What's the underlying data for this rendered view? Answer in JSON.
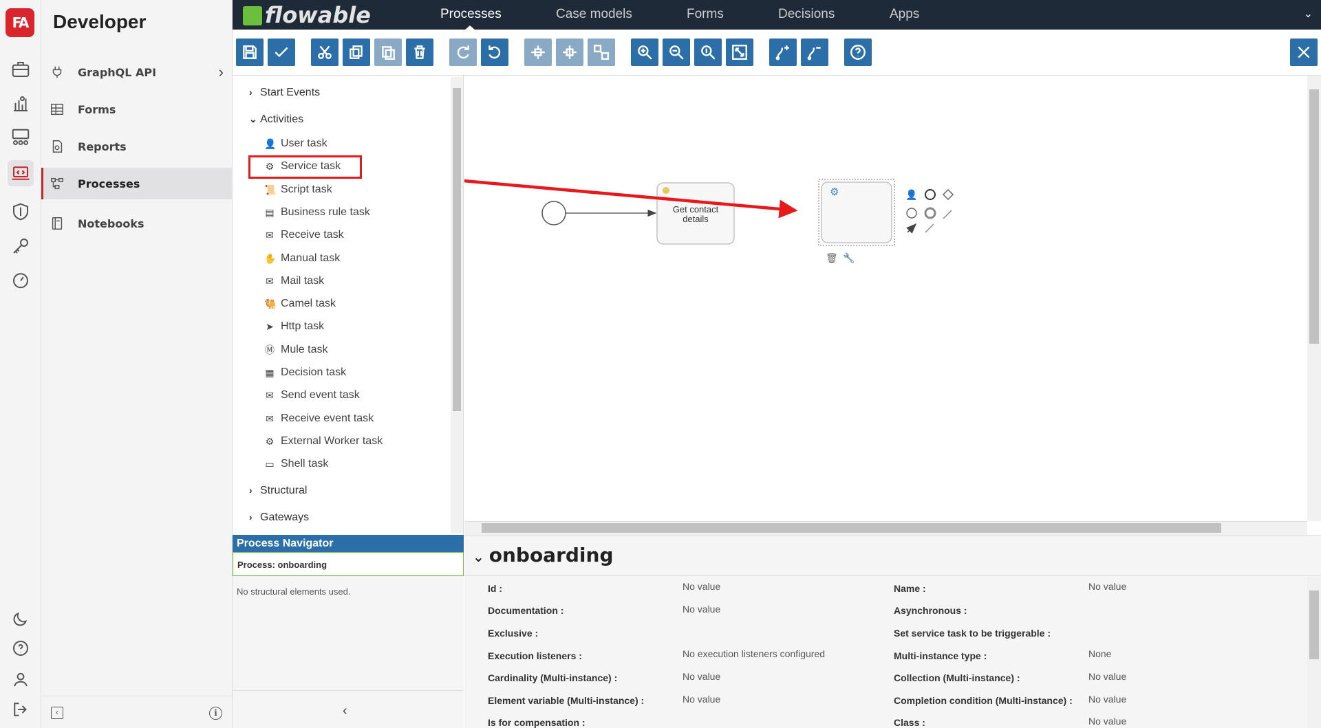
{
  "app": {
    "logo_text": "FA",
    "title": "Developer",
    "brand": "flowable"
  },
  "sidebar": {
    "items": [
      {
        "label": "GraphQL API",
        "icon": "plug-icon"
      },
      {
        "label": "Forms",
        "icon": "table-icon"
      },
      {
        "label": "Reports",
        "icon": "report-icon"
      },
      {
        "label": "Processes",
        "icon": "process-icon",
        "active": true
      },
      {
        "label": "Notebooks",
        "icon": "notebook-icon"
      }
    ]
  },
  "topnav": [
    "Processes",
    "Case models",
    "Forms",
    "Decisions",
    "Apps"
  ],
  "palette": {
    "groups": {
      "start": "Start Events",
      "activities": "Activities",
      "structural": "Structural",
      "gateways": "Gateways"
    },
    "items": [
      {
        "label": "User task",
        "glyph": "👤"
      },
      {
        "label": "Service task",
        "glyph": "⚙"
      },
      {
        "label": "Script task",
        "glyph": "📜"
      },
      {
        "label": "Business rule task",
        "glyph": "▤"
      },
      {
        "label": "Receive task",
        "glyph": "✉"
      },
      {
        "label": "Manual task",
        "glyph": "✋"
      },
      {
        "label": "Mail task",
        "glyph": "✉"
      },
      {
        "label": "Camel task",
        "glyph": "🐫"
      },
      {
        "label": "Http task",
        "glyph": "➤"
      },
      {
        "label": "Mule task",
        "glyph": "Ⓜ"
      },
      {
        "label": "Decision task",
        "glyph": "▦"
      },
      {
        "label": "Send event task",
        "glyph": "✉"
      },
      {
        "label": "Receive event task",
        "glyph": "✉"
      },
      {
        "label": "External Worker task",
        "glyph": "⚙"
      },
      {
        "label": "Shell task",
        "glyph": "▭"
      }
    ]
  },
  "navigator": {
    "title": "Process Navigator",
    "process": "Process: onboarding",
    "empty": "No structural elements used."
  },
  "diagram": {
    "task_label": "Get contact details"
  },
  "properties": {
    "title": "onboarding",
    "left": [
      {
        "label": "Id :",
        "value": "No value"
      },
      {
        "label": "Documentation :",
        "value": "No value"
      },
      {
        "label": "Exclusive :",
        "value": ""
      },
      {
        "label": "Execution listeners :",
        "value": "No execution listeners configured"
      },
      {
        "label": "Cardinality (Multi-instance) :",
        "value": "No value"
      },
      {
        "label": "Element variable (Multi-instance) :",
        "value": "No value"
      },
      {
        "label": "Is for compensation :",
        "value": ""
      }
    ],
    "right": [
      {
        "label": "Name :",
        "value": "No value"
      },
      {
        "label": "Asynchronous :",
        "value": ""
      },
      {
        "label": "Set service task to be triggerable :",
        "value": ""
      },
      {
        "label": "Multi-instance type :",
        "value": "None"
      },
      {
        "label": "Collection (Multi-instance) :",
        "value": "No value"
      },
      {
        "label": "Completion condition (Multi-instance) :",
        "value": "No value"
      },
      {
        "label": "Class :",
        "value": "No value"
      }
    ]
  },
  "colors": {
    "accent": "#2b6ea8",
    "brand_red": "#c0272d",
    "highlight": "#e8191a",
    "topbar": "#1e2a38"
  }
}
